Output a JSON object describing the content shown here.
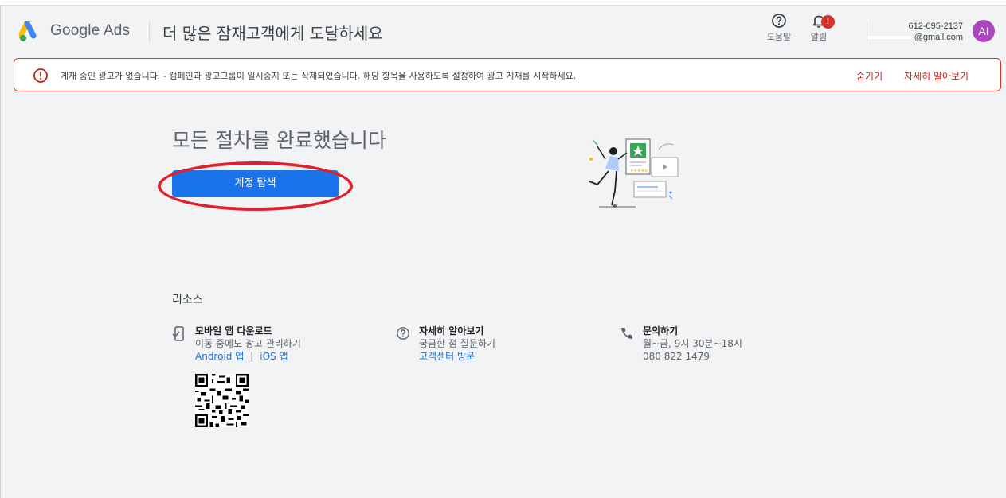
{
  "header": {
    "brand": "Google Ads",
    "title": "더 많은 잠재고객에게 도달하세요",
    "help_label": "도움말",
    "notifications_label": "알림",
    "notification_badge": "!",
    "account_id": "612-095-2137",
    "account_email": "@gmail.com",
    "avatar_initials": "AI"
  },
  "alert": {
    "message": "게재 중인 광고가 없습니다. - 캠페인과 광고그룹이 일시중지 또는 삭제되었습니다. 해당 항목을 사용하도록 설정하여 광고 게재를 시작하세요.",
    "hide_label": "숨기기",
    "learn_more_label": "자세히 알아보기"
  },
  "main": {
    "title": "모든 절차를 완료했습니다",
    "explore_button": "계정 탐색"
  },
  "resources": {
    "title": "리소스",
    "mobile": {
      "title": "모바일 앱 다운로드",
      "subtitle": "이동 중에도 광고 관리하기",
      "android_link": "Android 앱",
      "separator": "|",
      "ios_link": "iOS 앱"
    },
    "learn": {
      "title": "자세히 알아보기",
      "subtitle": "궁금한 점 질문하기",
      "link": "고객센터 방문"
    },
    "contact": {
      "title": "문의하기",
      "hours": "월~금, 9시 30분~18시",
      "phone": "080 822 1479"
    }
  },
  "colors": {
    "primary": "#1a73e8",
    "alert_red": "#d93025",
    "avatar": "#ab47bc",
    "highlight": "#e0212b"
  }
}
